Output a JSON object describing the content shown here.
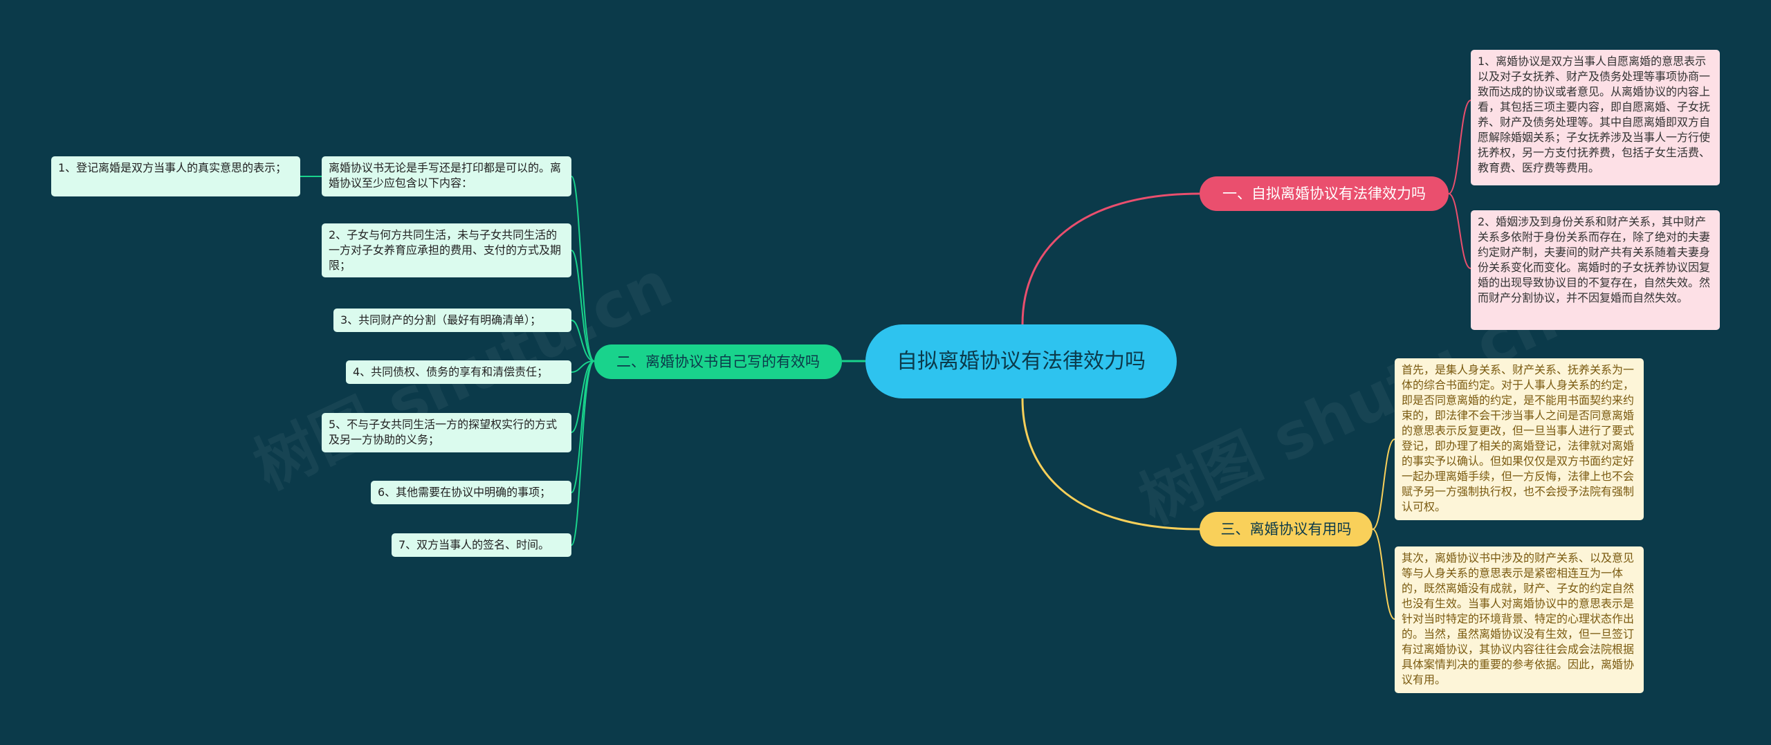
{
  "root": {
    "title": "自拟离婚协议有法律效力吗"
  },
  "branches": [
    {
      "label": "一、自拟离婚协议有法律效力吗",
      "color": "#ea4f6e",
      "leaves": [
        "1、离婚协议是双方当事人自愿离婚的意思表示以及对子女抚养、财产及债务处理等事项协商一致而达成的协议或者意见。从离婚协议的内容上看，其包括三项主要内容，即自愿离婚、子女抚养、财产及债务处理等。其中自愿离婚即双方自愿解除婚姻关系；子女抚养涉及当事人一方行使抚养权，另一方支付抚养费，包括子女生活费、教育费、医疗费等费用。",
        "2、婚姻涉及到身份关系和财产关系，其中财产关系多依附于身份关系而存在，除了绝对的夫妻约定财产制，夫妻间的财产共有关系随着夫妻身份关系变化而变化。离婚时的子女抚养协议因复婚的出现导致协议目的不复存在，自然失效。然而财产分割协议，并不因复婚而自然失效。"
      ]
    },
    {
      "label": "二、离婚协议书自己写的有效吗",
      "color": "#19d38c",
      "leaves": [
        "离婚协议书无论是手写还是打印都是可以的。离婚协议至少应包含以下内容：",
        "2、子女与何方共同生活，未与子女共同生活的一方对子女养育应承担的费用、支付的方式及期限；",
        "3、共同财产的分割（最好有明确清单）；",
        "4、共同债权、债务的享有和清偿责任；",
        "5、不与子女共同生活一方的探望权实行的方式及另一方协助的义务；",
        "6、其他需要在协议中明确的事项；",
        "7、双方当事人的签名、时间。"
      ],
      "sub_leaf": "1、登记离婚是双方当事人的真实意思的表示；"
    },
    {
      "label": "三、离婚协议有用吗",
      "color": "#f9d05a",
      "leaves": [
        "首先，是集人身关系、财产关系、抚养关系为一体的综合书面约定。对于人事人身关系的约定，即是否同意离婚的约定，是不能用书面契约来约束的，即法律不会干涉当事人之间是否同意离婚的意思表示反复更改，但一旦当事人进行了要式登记，即办理了相关的离婚登记，法律就对离婚的事实予以确认。但如果仅仅是双方书面约定好一起办理离婚手续，但一方反悔，法律上也不会赋予另一方强制执行权，也不会授予法院有强制认可权。",
        "其次，离婚协议书中涉及的财产关系、以及意见等与人身关系的意思表示是紧密相连互为一体的，既然离婚没有成就，财产、子女的约定自然也没有生效。当事人对离婚协议中的意思表示是针对当时特定的环境背景、特定的心理状态作出的。当然，虽然离婚协议没有生效，但一旦签订有过离婚协议，其协议内容往往会成会法院根据具体案情判决的重要的参考依据。因此，离婚协议有用。"
      ]
    }
  ]
}
